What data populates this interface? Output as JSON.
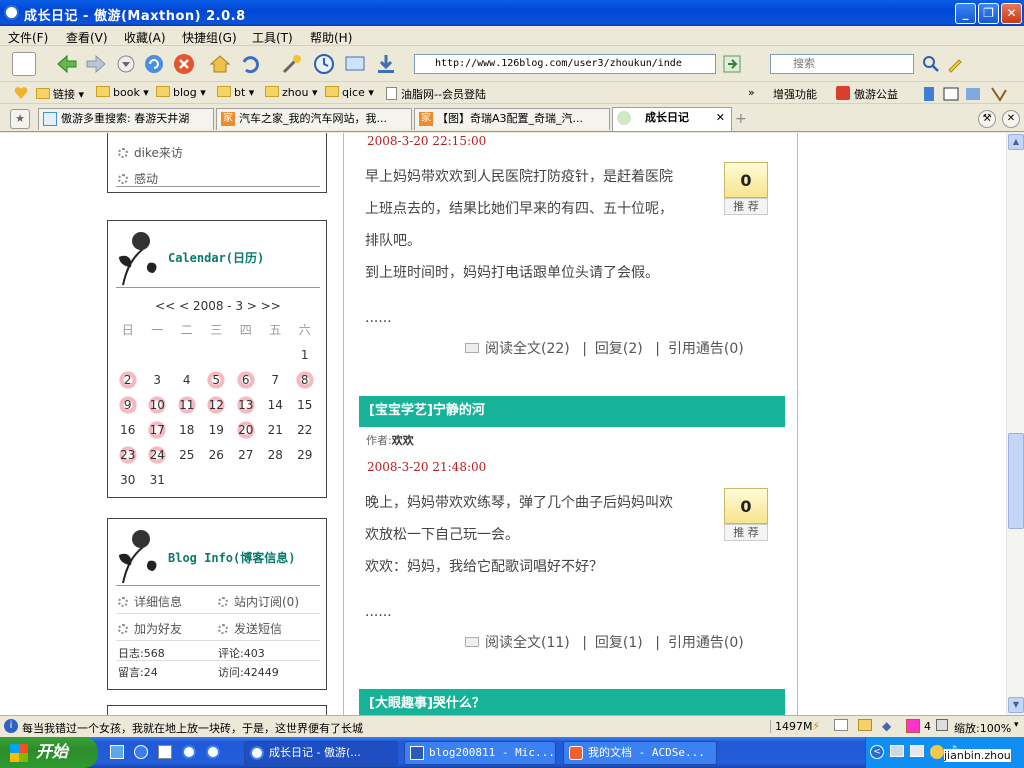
{
  "window": {
    "title": "成长日记 - 傲游(Maxthon) 2.0.8"
  },
  "menu": [
    "文件(F)",
    "查看(V)",
    "收藏(A)",
    "快捷组(G)",
    "工具(T)",
    "帮助(H)"
  ],
  "address": {
    "url": "http://www.126blog.com/user3/zhoukun/inde",
    "search_placeholder": "搜索"
  },
  "favorites": {
    "items": [
      "链接",
      "book",
      "blog",
      "bt",
      "zhou",
      "qice",
      "油脂网--会员登陆"
    ],
    "right": [
      "增强功能",
      "傲游公益"
    ]
  },
  "tabs": [
    {
      "label": "傲游多重搜索: 春游天井湖"
    },
    {
      "label": "汽车之家_我的汽车网站，我..."
    },
    {
      "label": "【图】奇瑞A3配置_奇瑞_汽..."
    },
    {
      "label": "成长日记",
      "active": true
    }
  ],
  "sidebar": {
    "top_links": [
      "dike来访",
      "感动"
    ],
    "calendar": {
      "title": "Calendar(日历)",
      "nav": "<< < 2008 - 3 > >>",
      "weekdays": [
        "日",
        "一",
        "二",
        "三",
        "四",
        "五",
        "六"
      ],
      "weeks": [
        [
          "",
          "",
          "",
          "",
          "",
          "",
          "1"
        ],
        [
          "2",
          "3",
          "4",
          "5",
          "6",
          "7",
          "8"
        ],
        [
          "9",
          "10",
          "11",
          "12",
          "13",
          "14",
          "15"
        ],
        [
          "16",
          "17",
          "18",
          "19",
          "20",
          "21",
          "22"
        ],
        [
          "23",
          "24",
          "25",
          "26",
          "27",
          "28",
          "29"
        ],
        [
          "30",
          "31",
          "",
          "",
          "",
          "",
          ""
        ]
      ],
      "highlighted": [
        "2",
        "5",
        "6",
        "8",
        "9",
        "10",
        "11",
        "12",
        "13",
        "17",
        "20",
        "23",
        "24"
      ]
    },
    "bloginfo": {
      "title": "Blog Info(博客信息)",
      "links": [
        "详细信息",
        "站内订阅(0)",
        "加为好友",
        "发送短信"
      ],
      "stats": {
        "posts": "日志:568",
        "comments": "评论:403",
        "messages": "留言:24",
        "visits": "访问:42449"
      }
    }
  },
  "posts": [
    {
      "date": "2008-3-20 22:15:00",
      "lines": [
        "早上妈妈带欢欢到人民医院打防疫针，是赶着医院",
        "上班点去的，结果比她们早来的有四、五十位呢，",
        "排队吧。",
        "到上班时间时，妈妈打电话跟单位头请了会假。"
      ],
      "ellipsis": "......",
      "recommend": {
        "count": "0",
        "label": "推 荐"
      },
      "actions": {
        "read": "阅读全文(22)",
        "reply": "回复(2)",
        "trackback": "引用通告(0)"
      }
    },
    {
      "title": "[宝宝学艺]宁静的河",
      "author_label": "作者:",
      "author": "欢欢",
      "date": "2008-3-20 21:48:00",
      "lines": [
        "晚上，妈妈带欢欢练琴，弹了几个曲子后妈妈叫欢",
        "欢放松一下自己玩一会。",
        "欢欢：妈妈，我给它配歌词唱好不好？"
      ],
      "ellipsis": "......",
      "recommend": {
        "count": "0",
        "label": "推 荐"
      },
      "actions": {
        "read": "阅读全文(11)",
        "reply": "回复(1)",
        "trackback": "引用通告(0)"
      }
    },
    {
      "title": "[大眼趣事]哭什么？"
    }
  ],
  "status": {
    "text": "每当我错过一个女孩，我就在地上放一块砖，于是，这世界便有了长城",
    "memory": "1497M",
    "count": "4",
    "zoom": "缩放:100%"
  },
  "taskbar": {
    "start": "开始",
    "tasks": [
      "成长日记 - 傲游(...",
      "blog200811 - Mic...",
      "我的文档 - ACDSe..."
    ],
    "user": "jianbin.zhou"
  },
  "colors": {
    "teal_bar": "#17b398",
    "date_red": "#b81d1d",
    "title_teal": "#0b7a6a"
  }
}
